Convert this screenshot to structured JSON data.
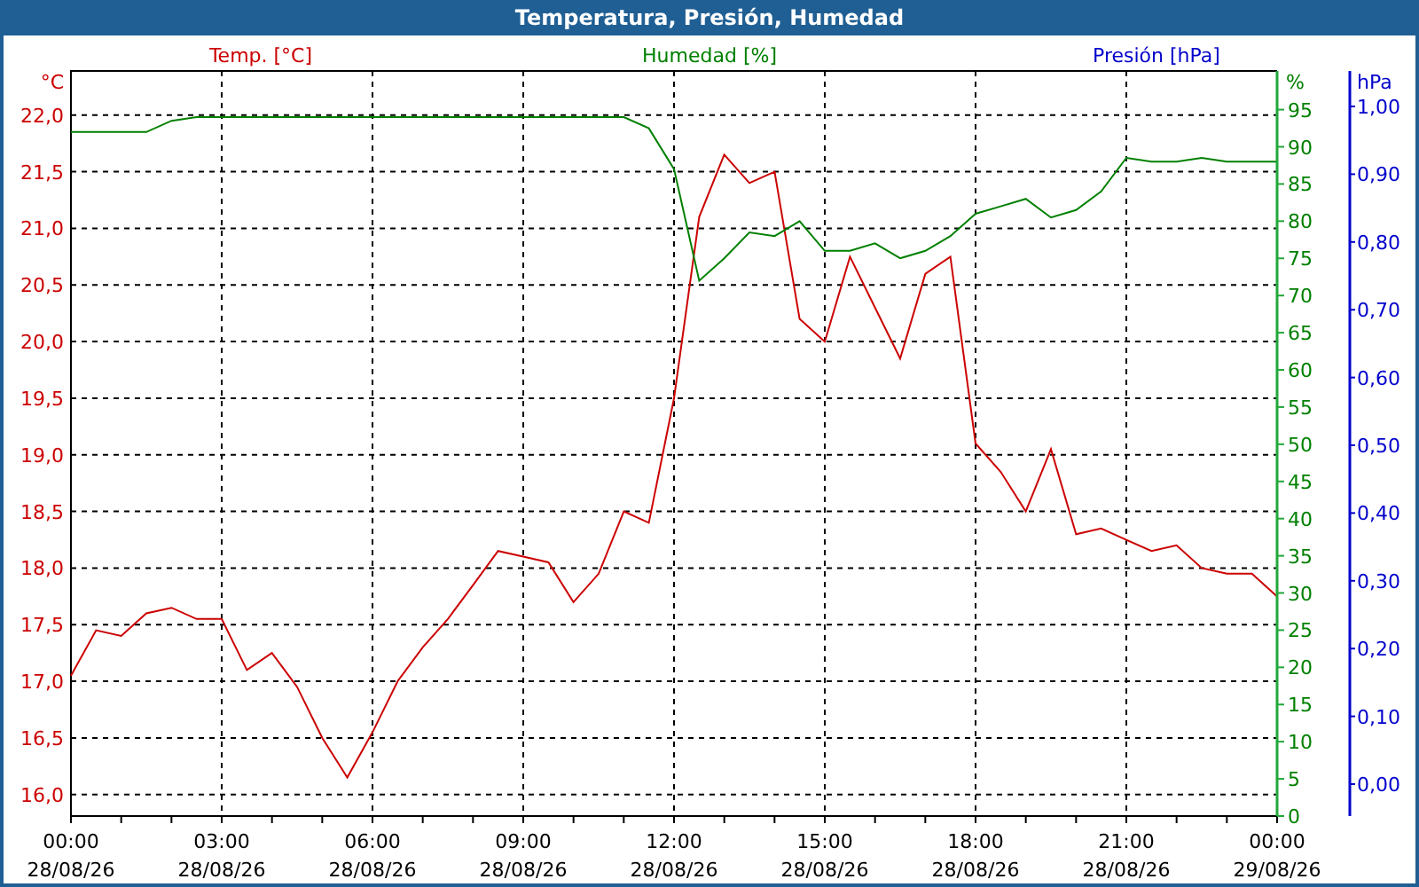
{
  "window": {
    "title": "Temperatura, Presión, Humedad"
  },
  "chart": {
    "chart_data": {
      "type": "line",
      "categories": [
        "00:00\n28/08/26",
        null,
        null,
        null,
        null,
        null,
        "03:00\n28/08/26",
        null,
        null,
        null,
        null,
        null,
        "06:00\n28/08/26",
        null,
        null,
        null,
        null,
        null,
        "09:00\n28/08/26",
        null,
        null,
        null,
        null,
        null,
        "12:00\n28/08/26",
        null,
        null,
        null,
        null,
        null,
        "15:00\n28/08/26",
        null,
        null,
        null,
        null,
        null,
        "18:00\n28/08/26",
        null,
        null,
        null,
        null,
        null,
        "21:00\n28/08/26",
        null,
        null,
        null,
        null,
        null,
        "00:00\n29/08/26"
      ],
      "ylabel": "°C",
      "ylim": [
        15.81,
        22.39
      ],
      "yticks": [
        {
          "value": 22,
          "label": "22,0"
        },
        {
          "value": 21.5,
          "label": "21,5"
        },
        {
          "value": 21,
          "label": "21,0"
        },
        {
          "value": 20.5,
          "label": "20,5"
        },
        {
          "value": 20,
          "label": "20,0"
        },
        {
          "value": 19.5,
          "label": "19,5"
        },
        {
          "value": 19,
          "label": "19,0"
        },
        {
          "value": 18.5,
          "label": "18,5"
        },
        {
          "value": 18,
          "label": "18,0"
        },
        {
          "value": 17.5,
          "label": "17,5"
        },
        {
          "value": 17,
          "label": "17,0"
        },
        {
          "value": 16.5,
          "label": "16,5"
        },
        {
          "value": 16,
          "label": "16,0"
        }
      ],
      "series": [
        {
          "name": "Temp. [°C]",
          "color": "#cc0000",
          "axis": "y",
          "values": [
            17.05,
            17.45,
            17.4,
            17.6,
            17.65,
            17.55,
            17.55,
            17.1,
            17.25,
            16.95,
            16.5,
            16.15,
            16.55,
            17.0,
            17.3,
            17.55,
            17.85,
            18.15,
            18.1,
            18.05,
            17.7,
            17.95,
            18.5,
            18.4,
            19.5,
            21.1,
            21.65,
            21.4,
            21.5,
            20.2,
            20.0,
            20.75,
            20.3,
            19.85,
            20.6,
            20.75,
            19.1,
            18.85,
            18.5,
            19.05,
            18.3,
            18.35,
            18.25,
            18.15,
            18.2,
            18.0,
            17.95,
            17.95,
            17.75
          ]
        },
        {
          "name": "Humedad [%]",
          "color": "#008000",
          "axis": "y2",
          "values": [
            92,
            92,
            92,
            92,
            93.5,
            94,
            94,
            94,
            94,
            94,
            94,
            94,
            94,
            94,
            94,
            94,
            94,
            94,
            94,
            94,
            94,
            94,
            94,
            92.5,
            87,
            72,
            75,
            78.5,
            78,
            80,
            76,
            76,
            77,
            75,
            76,
            78,
            81,
            82,
            83,
            80.5,
            81.5,
            84,
            88.5,
            88,
            88,
            88.5,
            88,
            88,
            88
          ]
        }
      ],
      "grid": true,
      "y2label": "%",
      "y2lim": [
        0,
        100.2
      ],
      "y2ticks": [
        {
          "value": 95,
          "label": "95"
        },
        {
          "value": 90,
          "label": "90"
        },
        {
          "value": 85,
          "label": "85"
        },
        {
          "value": 80,
          "label": "80"
        },
        {
          "value": 75,
          "label": "75"
        },
        {
          "value": 70,
          "label": "70"
        },
        {
          "value": 65,
          "label": "65"
        },
        {
          "value": 60,
          "label": "60"
        },
        {
          "value": 55,
          "label": "55"
        },
        {
          "value": 50,
          "label": "50"
        },
        {
          "value": 45,
          "label": "45"
        },
        {
          "value": 40,
          "label": "40"
        },
        {
          "value": 35,
          "label": "35"
        },
        {
          "value": 30,
          "label": "30"
        },
        {
          "value": 25,
          "label": "25"
        },
        {
          "value": 20,
          "label": "20"
        },
        {
          "value": 15,
          "label": "15"
        },
        {
          "value": 10,
          "label": "10"
        },
        {
          "value": 5,
          "label": "5"
        },
        {
          "value": 0,
          "label": "0"
        }
      ]
    },
    "pressure_axis": {
      "title": "Presión [hPa]",
      "unit": "hPa",
      "tick_labels": [
        "1,00",
        "0,90",
        "0,80",
        "0,70",
        "0,60",
        "0,50",
        "0,40",
        "0,30",
        "0,20",
        "0,10",
        "0,00"
      ]
    }
  }
}
